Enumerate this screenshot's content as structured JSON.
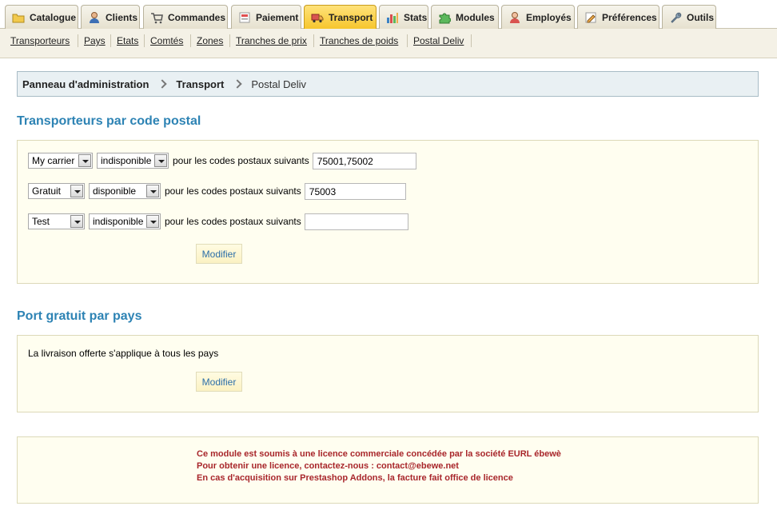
{
  "tabs": [
    {
      "label": "Catalogue",
      "icon": "folder-icon",
      "active": false
    },
    {
      "label": "Clients",
      "icon": "user-icon",
      "active": false
    },
    {
      "label": "Commandes",
      "icon": "cart-icon",
      "active": false
    },
    {
      "label": "Paiement",
      "icon": "payment-icon",
      "active": false
    },
    {
      "label": "Transport",
      "icon": "truck-icon",
      "active": true
    },
    {
      "label": "Stats",
      "icon": "bar-chart-icon",
      "active": false
    },
    {
      "label": "Modules",
      "icon": "puzzle-icon",
      "active": false
    },
    {
      "label": "Employés",
      "icon": "employee-icon",
      "active": false
    },
    {
      "label": "Préférences",
      "icon": "preferences-icon",
      "active": false
    },
    {
      "label": "Outils",
      "icon": "wrench-icon",
      "active": false
    }
  ],
  "subnav": [
    "Transporteurs",
    "Pays",
    "Etats",
    "Comtés",
    "Zones",
    "Tranches de prix",
    "Tranches de poids",
    "Postal Deliv"
  ],
  "breadcrumb": [
    "Panneau d'administration",
    "Transport",
    "Postal Deliv"
  ],
  "carriers_section": {
    "title": "Transporteurs par code postal",
    "suffix_text": "pour les codes postaux suivants",
    "rows": [
      {
        "carrier": "My carrier",
        "availability": "indisponible",
        "postcodes": "75001,75002"
      },
      {
        "carrier": "Gratuit",
        "availability": "disponible",
        "postcodes": "75003"
      },
      {
        "carrier": "Test",
        "availability": "indisponible",
        "postcodes": ""
      }
    ],
    "button": "Modifier"
  },
  "free_shipping_section": {
    "title": "Port gratuit par pays",
    "text": "La livraison offerte s'applique à tous les pays",
    "button": "Modifier"
  },
  "license": [
    "Ce module est soumis à une licence commerciale concédée par la société EURL ébewè",
    "Pour obtenir une licence, contactez-nous : contact@ebewe.net",
    "En cas d'acquisition sur Prestashop Addons, la facture fait office de licence"
  ],
  "colors": {
    "accent": "#2d83b4",
    "active_tab": "#f6c52a",
    "panel_bg": "#fffef0",
    "license_text": "#a8262b"
  }
}
